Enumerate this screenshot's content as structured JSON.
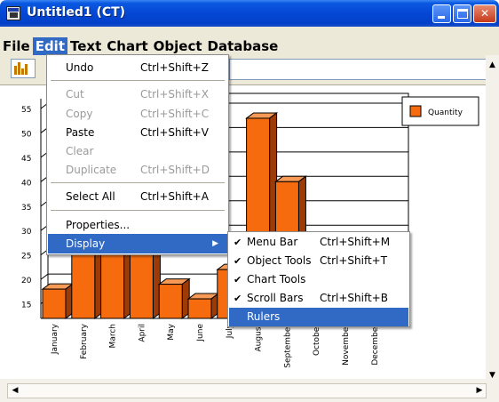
{
  "window": {
    "title": "Untitled1 (CT)"
  },
  "menubar": {
    "items": [
      {
        "label": "File",
        "active": false
      },
      {
        "label": "Edit",
        "active": true
      },
      {
        "label": "Text",
        "active": false
      },
      {
        "label": "Chart",
        "active": false
      },
      {
        "label": "Object",
        "active": false
      },
      {
        "label": "Database",
        "active": false
      }
    ]
  },
  "edit_menu": {
    "undo": {
      "label": "Undo",
      "shortcut": "Ctrl+Shift+Z"
    },
    "cut": {
      "label": "Cut",
      "shortcut": "Ctrl+Shift+X"
    },
    "copy": {
      "label": "Copy",
      "shortcut": "Ctrl+Shift+C"
    },
    "paste": {
      "label": "Paste",
      "shortcut": "Ctrl+Shift+V"
    },
    "clear": {
      "label": "Clear"
    },
    "duplicate": {
      "label": "Duplicate",
      "shortcut": "Ctrl+Shift+D"
    },
    "select_all": {
      "label": "Select All",
      "shortcut": "Ctrl+Shift+A"
    },
    "properties": {
      "label": "Properties..."
    },
    "display": {
      "label": "Display"
    }
  },
  "display_menu": {
    "menu_bar": {
      "label": "Menu Bar",
      "shortcut": "Ctrl+Shift+M",
      "checked": true
    },
    "object_tools": {
      "label": "Object Tools",
      "shortcut": "Ctrl+Shift+T",
      "checked": true
    },
    "chart_tools": {
      "label": "Chart Tools",
      "checked": true
    },
    "scroll_bars": {
      "label": "Scroll Bars",
      "shortcut": "Ctrl+Shift+B",
      "checked": true
    },
    "rulers": {
      "label": "Rulers",
      "checked": false
    }
  },
  "colors": {
    "accent": "#316ac5",
    "bar_front": "#f66b0e",
    "bar_side": "#9c3b06",
    "bar_top": "#f79a55"
  },
  "chart_data": {
    "type": "bar",
    "categories": [
      "January",
      "February",
      "March",
      "April",
      "May",
      "June",
      "July",
      "August",
      "September",
      "October",
      "November",
      "December"
    ],
    "series": [
      {
        "name": "Quantity",
        "values": [
          18,
          32,
          30,
          29,
          19,
          16,
          22,
          53,
          40,
          null,
          null,
          null
        ]
      }
    ],
    "yticks": [
      15,
      20,
      25,
      30,
      35,
      40,
      45,
      50,
      55
    ],
    "ylim": [
      12,
      57
    ],
    "legend": "top-right",
    "grid": true
  }
}
